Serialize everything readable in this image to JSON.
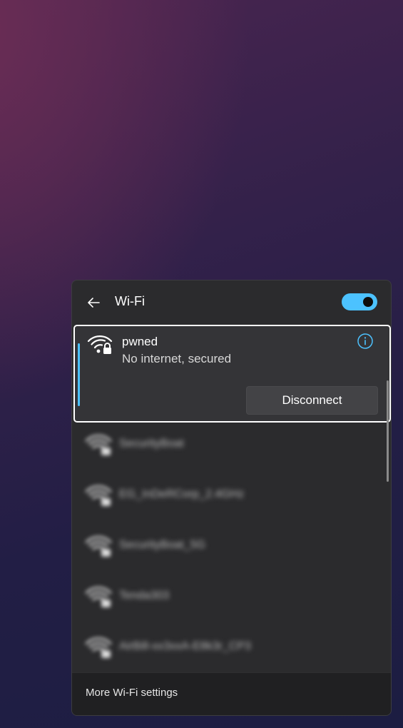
{
  "flyout": {
    "title": "Wi-Fi",
    "wifi_enabled": true,
    "accent_color": "#4cc2ff"
  },
  "connected_network": {
    "name": "pwned",
    "status": "No internet, secured",
    "disconnect_label": "Disconnect",
    "icon": "wifi-secured-icon"
  },
  "networks": [
    {
      "name": "SecurityBoat",
      "icon": "wifi-secured-icon"
    },
    {
      "name": "EG_InDeRCorp_2.4GHz",
      "icon": "wifi-secured-icon"
    },
    {
      "name": "SecurityBoat_5G",
      "icon": "wifi-secured-icon"
    },
    {
      "name": "Tenda303",
      "icon": "wifi-secured-icon"
    },
    {
      "name": "AirBill-xx3xxA-E8k3r_CP3",
      "icon": "wifi-secured-icon"
    }
  ],
  "footer": {
    "more_settings_label": "More Wi-Fi settings"
  }
}
